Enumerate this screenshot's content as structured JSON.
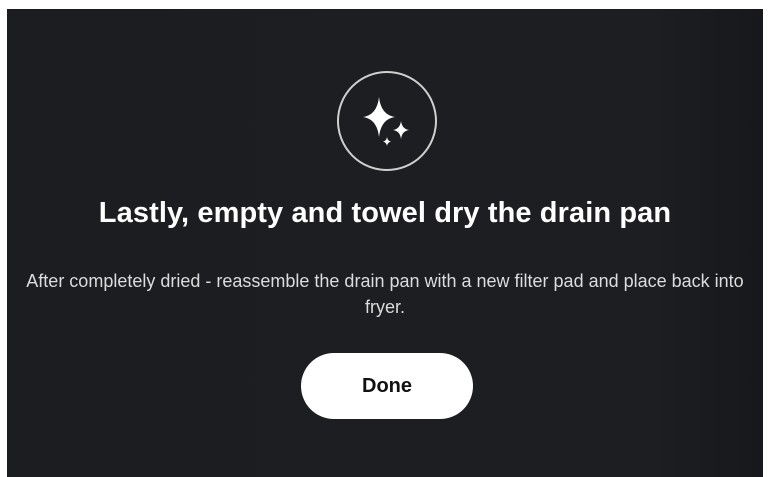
{
  "dialog": {
    "icon": "sparkles-icon",
    "title": "Lastly, empty and towel dry the drain pan",
    "description": "After completely dried - reassemble the drain pan with a new filter pad and place back into fryer.",
    "done_label": "Done"
  },
  "colors": {
    "background": "#1c1d21",
    "text": "#ffffff",
    "button_bg": "#ffffff",
    "button_text": "#111111"
  }
}
